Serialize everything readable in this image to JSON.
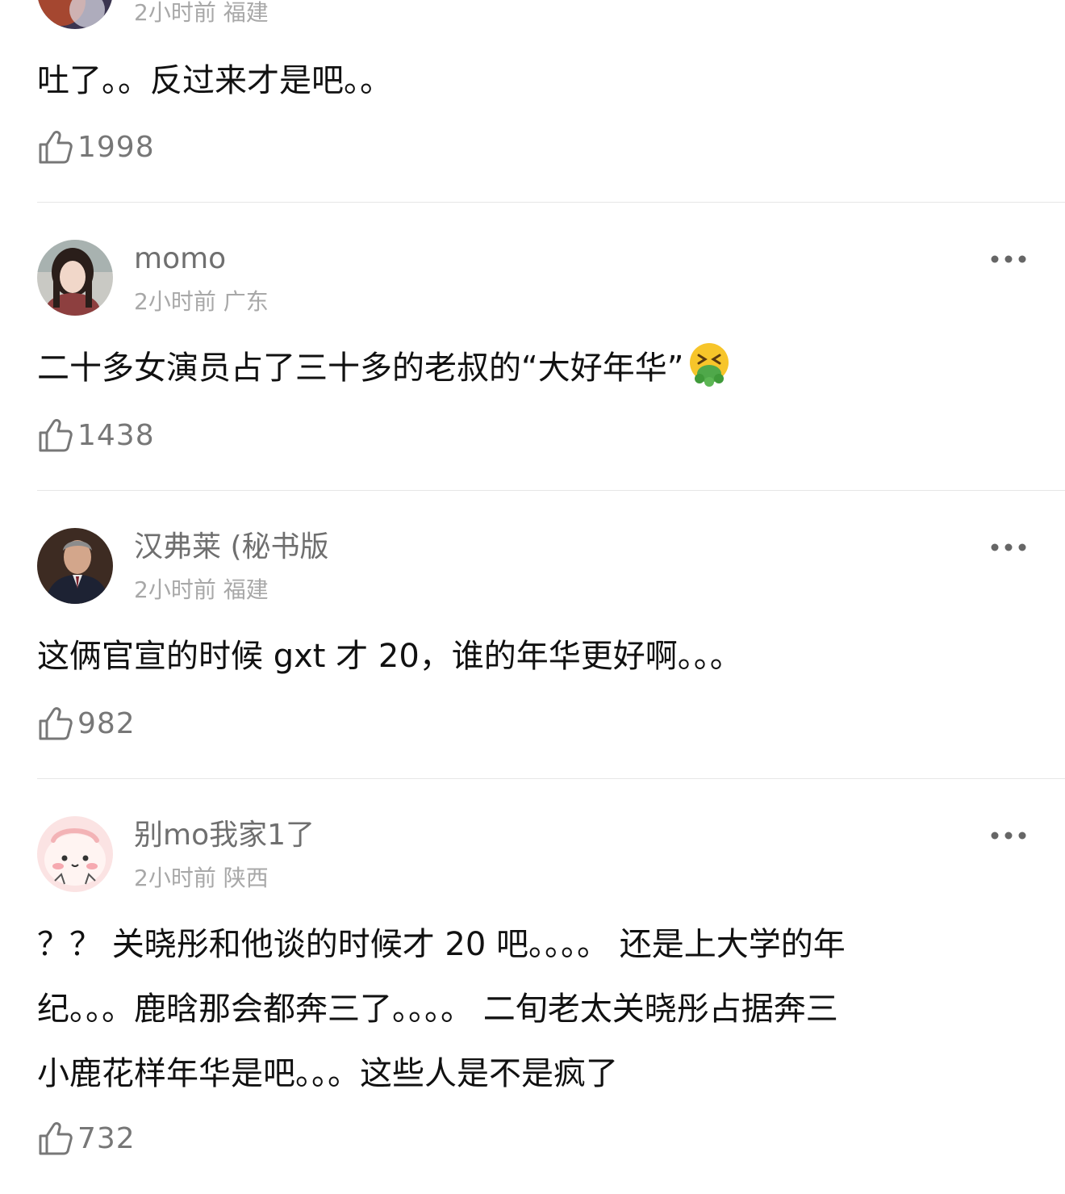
{
  "comments": [
    {
      "meta": "2小时前 福建",
      "text": "吐了。。反过来才是吧。。",
      "likes": "1998"
    },
    {
      "username": "momo",
      "meta": "2小时前 广东",
      "text": "二十多女演员占了三十多的老叔的“大好年华”",
      "emoji": "vomiting-face-icon",
      "likes": "1438"
    },
    {
      "username": "汉弗莱 (秘书版",
      "meta": "2小时前 福建",
      "text": "这俩官宣的时候 gxt 才 20，谁的年华更好啊。。。",
      "likes": "982"
    },
    {
      "username": "别mo我家1了",
      "meta": "2小时前 陕西",
      "text_lines": [
        "？？ 关晓彤和他谈的时候才 20 吧。。。。 还是上大学的年",
        "纪。。。鹿晗那会都奔三了。。。。 二旬老太关晓彤占据奔三",
        "小鹿花样年华是吧。。。这些人是不是疯了"
      ],
      "likes": "732"
    }
  ],
  "icons": {
    "like": "thumbs-up-icon",
    "more": "more-options-icon"
  },
  "colors": {
    "username": "#6f6f6f",
    "meta": "#a8a8a8",
    "text": "#111111",
    "divider": "#e6e6e6"
  }
}
